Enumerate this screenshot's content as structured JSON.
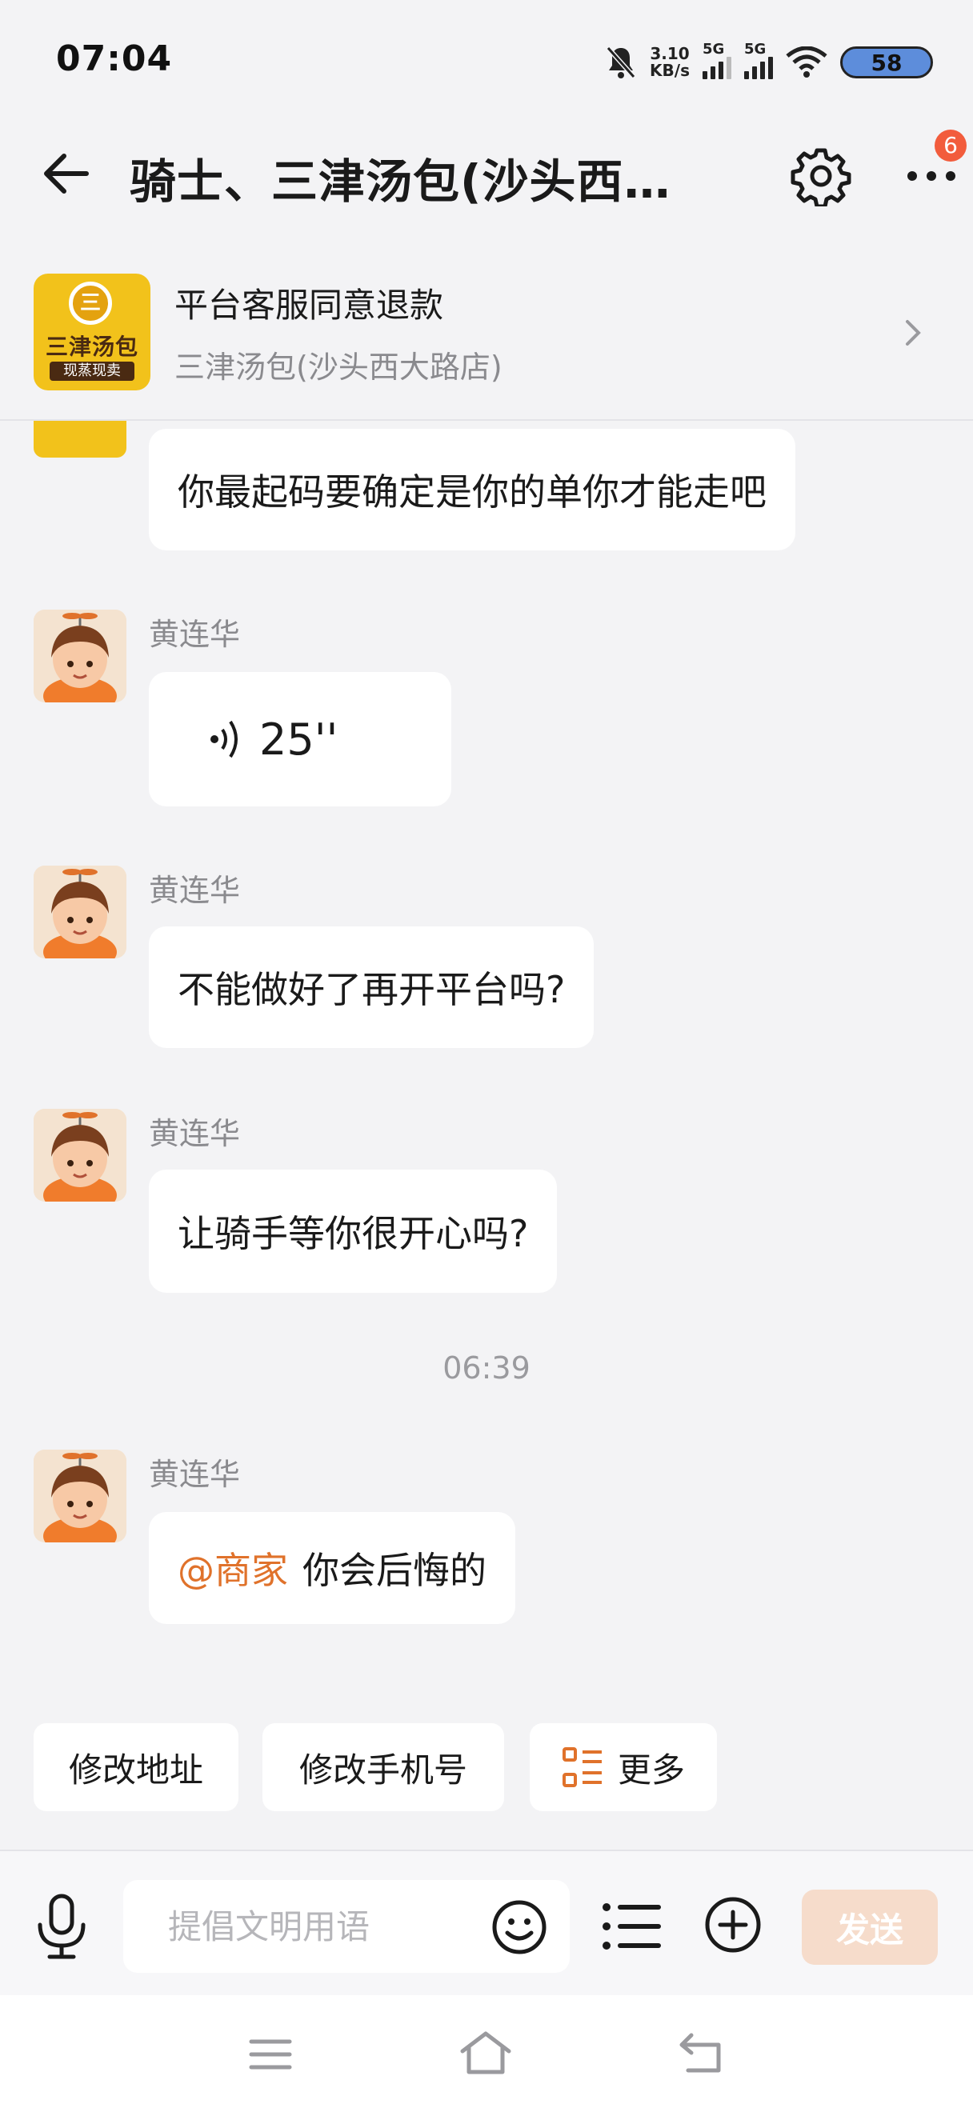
{
  "status_bar": {
    "time": "07:04",
    "speed_value": "3.10",
    "speed_unit": "KB/s",
    "network_1": "5G",
    "network_2": "5G",
    "battery": "58"
  },
  "header": {
    "title": "骑士、三津汤包(沙头西…",
    "notification_count": "6"
  },
  "order_card": {
    "logo_symbol": "三",
    "logo_name": "三津汤包",
    "logo_slogan": "现蒸现卖",
    "status": "平台客服同意退款",
    "shop_name": "三津汤包(沙头西大路店)"
  },
  "messages": [
    {
      "text": "你最起码要确定是你的单你才能走吧"
    },
    {
      "sender": "黄连华",
      "voice_duration": "25''"
    },
    {
      "sender": "黄连华",
      "text": "不能做好了再开平台吗?"
    },
    {
      "sender": "黄连华",
      "text": "让骑手等你很开心吗?"
    },
    {
      "sender": "黄连华",
      "mention": "@商家",
      "text": "你会后悔的"
    }
  ],
  "time_divider": "06:39",
  "quick_actions": [
    "修改地址",
    "修改手机号",
    "更多"
  ],
  "input": {
    "placeholder": "提倡文明用语",
    "send_label": "发送"
  },
  "colors": {
    "accent": "#e0722b",
    "badge": "#f25c3c",
    "send_disabled": "#f6dccb",
    "background": "#f3f3f5"
  }
}
